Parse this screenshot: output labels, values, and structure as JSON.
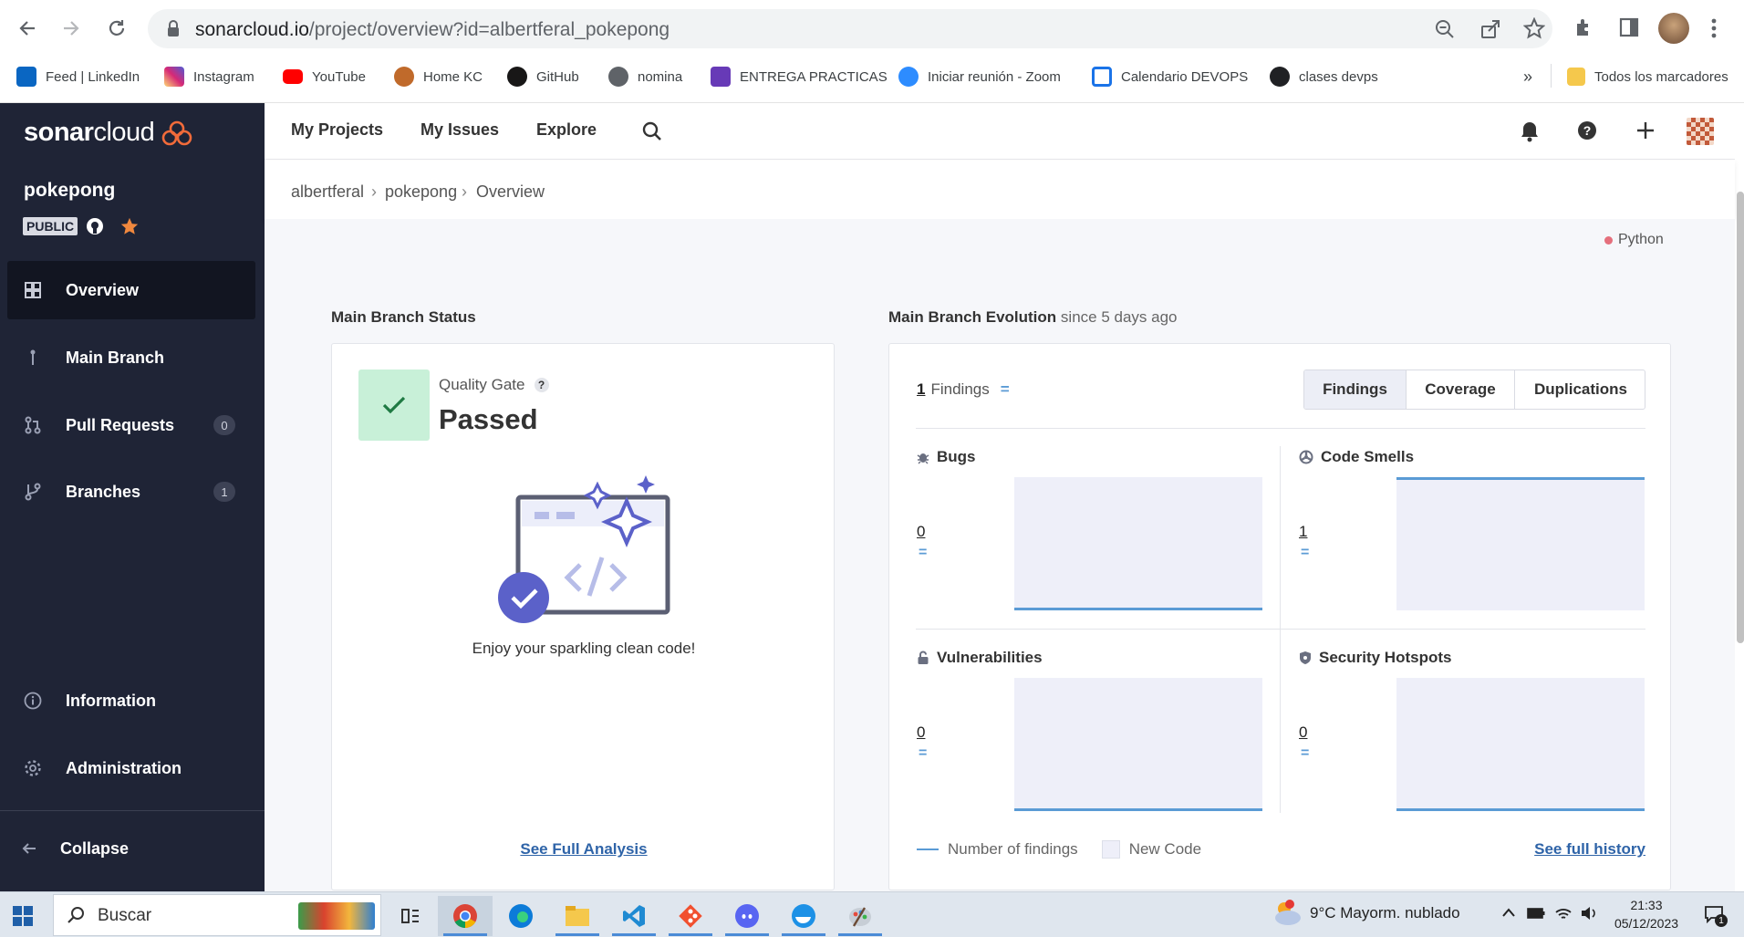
{
  "browser": {
    "url_host": "sonarcloud.io",
    "url_path": "/project/overview?id=albertferal_pokepong",
    "bookmarks": [
      {
        "label": "Feed | LinkedIn",
        "icon": "linkedin-icon",
        "color": "#0a66c2"
      },
      {
        "label": "Instagram",
        "icon": "instagram-icon",
        "color": "#d62976"
      },
      {
        "label": "YouTube",
        "icon": "youtube-icon",
        "color": "#ff0000"
      },
      {
        "label": "Home KC",
        "icon": "home-kc-icon",
        "color": "#c06a2b"
      },
      {
        "label": "GitHub",
        "icon": "github-icon",
        "color": "#181717"
      },
      {
        "label": "nomina",
        "icon": "globe-icon",
        "color": "#5f6368"
      },
      {
        "label": "ENTREGA PRACTICAS",
        "icon": "forms-icon",
        "color": "#673ab7"
      },
      {
        "label": "Iniciar reunión - Zoom",
        "icon": "zoom-icon",
        "color": "#2d8cff"
      },
      {
        "label": "Calendario DEVOPS",
        "icon": "calendar-icon",
        "color": "#1a73e8"
      },
      {
        "label": "clases devps",
        "icon": "classes-icon",
        "color": "#202124"
      }
    ],
    "more_label": "»",
    "all_bookmarks": "Todos los marcadores"
  },
  "app": {
    "brand_bold": "sonar",
    "brand_light": "cloud",
    "nav": [
      "My Projects",
      "My Issues",
      "Explore"
    ],
    "project": {
      "name": "pokepong",
      "visibility": "PUBLIC"
    },
    "sidebar": {
      "overview": "Overview",
      "main_branch": "Main Branch",
      "pull_requests": "Pull Requests",
      "pull_requests_count": "0",
      "branches": "Branches",
      "branches_count": "1",
      "information": "Information",
      "administration": "Administration",
      "collapse": "Collapse"
    },
    "breadcrumb": {
      "org": "albertferal",
      "project": "pokepong",
      "page": "Overview",
      "sep": "›"
    }
  },
  "overview": {
    "language": "Python",
    "status": {
      "title": "Main Branch Status",
      "qg_label": "Quality Gate",
      "qg_help": "?",
      "qg_value": "Passed",
      "message": "Enjoy your sparkling clean code!",
      "link": "See Full Analysis"
    },
    "evolution": {
      "title": "Main Branch Evolution",
      "since": "since 5 days ago",
      "findings_count": "1",
      "findings_label": "Findings",
      "findings_eq": "=",
      "tabs": [
        "Findings",
        "Coverage",
        "Duplications"
      ],
      "active_tab": "Findings",
      "metrics": {
        "bugs": {
          "label": "Bugs",
          "value": "0",
          "eq": "="
        },
        "code_smells": {
          "label": "Code Smells",
          "value": "1",
          "eq": "="
        },
        "vulnerabilities": {
          "label": "Vulnerabilities",
          "value": "0",
          "eq": "="
        },
        "hotspots": {
          "label": "Security Hotspots",
          "value": "0",
          "eq": "="
        }
      },
      "legend_findings": "Number of findings",
      "legend_new_code": "New Code",
      "history_link": "See full history"
    }
  },
  "taskbar": {
    "search_placeholder": "Buscar",
    "weather": "9°C  Mayorm. nublado",
    "time": "21:33",
    "date": "05/12/2023",
    "notif_count": "1"
  },
  "colors": {
    "sidebar": "#1f2436",
    "accent_blue": "#5a9bd5",
    "passed_green": "#c8f0d8",
    "check_green": "#1f7a43",
    "red_line": "#e56f7c"
  }
}
